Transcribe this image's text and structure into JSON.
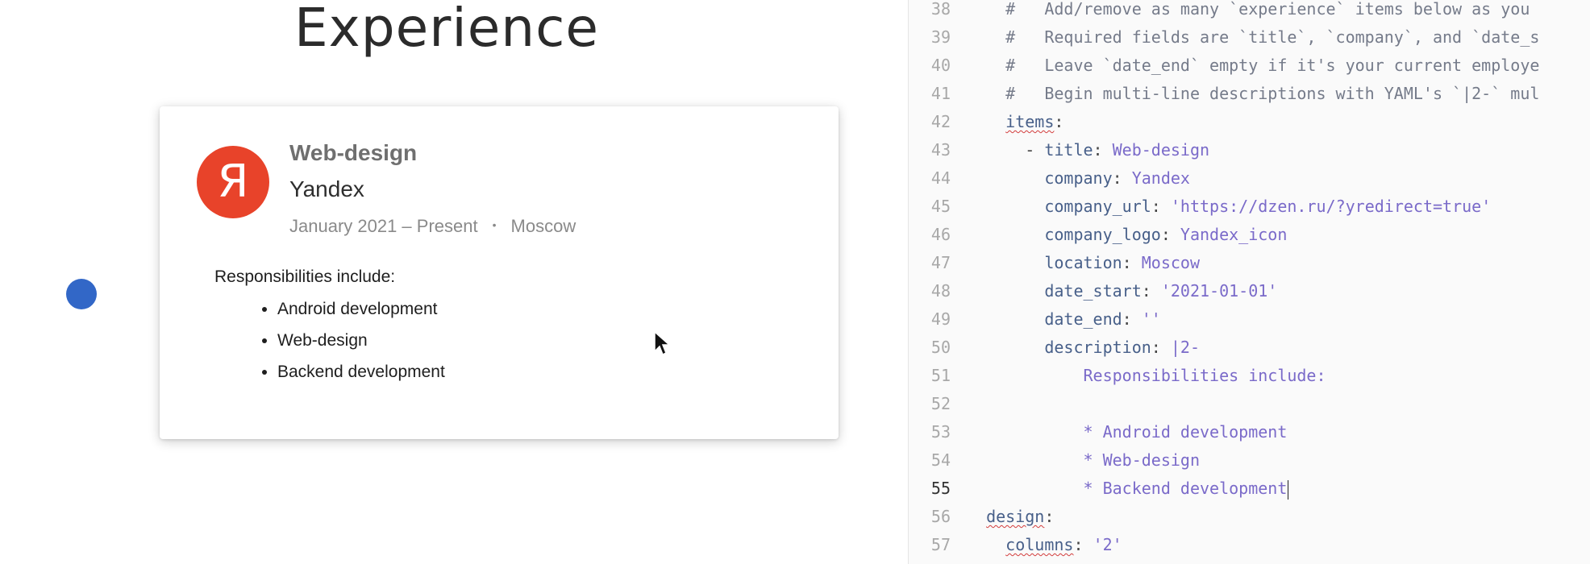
{
  "preview": {
    "section_title": "Experience",
    "entry": {
      "logo_letter": "Я",
      "title": "Web-design",
      "company": "Yandex",
      "date_range": "January 2021 – Present",
      "separator": "•",
      "location": "Moscow",
      "description_intro": "Responsibilities include:",
      "bullets": [
        "Android development",
        "Web-design",
        "Backend development"
      ]
    }
  },
  "editor": {
    "active_line": "55",
    "lines": [
      {
        "n": "38",
        "segs": [
          [
            "cm",
            "    #   Add/remove as many `experience` items below as you"
          ]
        ]
      },
      {
        "n": "39",
        "segs": [
          [
            "cm",
            "    #   Required fields are `title`, `company`, and `date_s"
          ]
        ]
      },
      {
        "n": "40",
        "segs": [
          [
            "cm",
            "    #   Leave `date_end` empty if it's your current employe"
          ]
        ]
      },
      {
        "n": "41",
        "segs": [
          [
            "cm",
            "    #   Begin multi-line descriptions with YAML's `|2-` mul"
          ]
        ]
      },
      {
        "n": "42",
        "segs": [
          [
            "plain",
            "    "
          ],
          [
            "key",
            "items"
          ],
          [
            "plain",
            ":"
          ]
        ]
      },
      {
        "n": "43",
        "segs": [
          [
            "plain",
            "      - "
          ],
          [
            "key",
            "title"
          ],
          [
            "plain",
            ": "
          ],
          [
            "val",
            "Web-design"
          ]
        ]
      },
      {
        "n": "44",
        "segs": [
          [
            "plain",
            "        "
          ],
          [
            "key",
            "company"
          ],
          [
            "plain",
            ": "
          ],
          [
            "val",
            "Yandex"
          ]
        ]
      },
      {
        "n": "45",
        "segs": [
          [
            "plain",
            "        "
          ],
          [
            "key",
            "company_url"
          ],
          [
            "plain",
            ": "
          ],
          [
            "val",
            "'https://dzen.ru/?yredirect=true'"
          ]
        ]
      },
      {
        "n": "46",
        "segs": [
          [
            "plain",
            "        "
          ],
          [
            "key",
            "company_logo"
          ],
          [
            "plain",
            ": "
          ],
          [
            "val",
            "Yandex_icon"
          ]
        ]
      },
      {
        "n": "47",
        "segs": [
          [
            "plain",
            "        "
          ],
          [
            "key",
            "location"
          ],
          [
            "plain",
            ": "
          ],
          [
            "val",
            "Moscow"
          ]
        ]
      },
      {
        "n": "48",
        "segs": [
          [
            "plain",
            "        "
          ],
          [
            "key",
            "date_start"
          ],
          [
            "plain",
            ": "
          ],
          [
            "val",
            "'2021-01-01'"
          ]
        ]
      },
      {
        "n": "49",
        "segs": [
          [
            "plain",
            "        "
          ],
          [
            "key",
            "date_end"
          ],
          [
            "plain",
            ": "
          ],
          [
            "val",
            "''"
          ]
        ]
      },
      {
        "n": "50",
        "segs": [
          [
            "plain",
            "        "
          ],
          [
            "key",
            "description"
          ],
          [
            "plain",
            ": "
          ],
          [
            "val",
            "|2-"
          ]
        ]
      },
      {
        "n": "51",
        "segs": [
          [
            "txt",
            "            Responsibilities include:"
          ]
        ]
      },
      {
        "n": "52",
        "segs": [
          [
            "txt",
            ""
          ]
        ]
      },
      {
        "n": "53",
        "segs": [
          [
            "txt",
            "            * Android development"
          ]
        ]
      },
      {
        "n": "54",
        "segs": [
          [
            "txt",
            "            * Web-design"
          ]
        ]
      },
      {
        "n": "55",
        "segs": [
          [
            "txt",
            "            * Backend development"
          ]
        ]
      },
      {
        "n": "56",
        "segs": [
          [
            "plain",
            "  "
          ],
          [
            "key",
            "design"
          ],
          [
            "plain",
            ":"
          ]
        ]
      },
      {
        "n": "57",
        "segs": [
          [
            "plain",
            "    "
          ],
          [
            "key",
            "columns"
          ],
          [
            "plain",
            ": "
          ],
          [
            "val",
            "'2'"
          ]
        ]
      }
    ]
  }
}
